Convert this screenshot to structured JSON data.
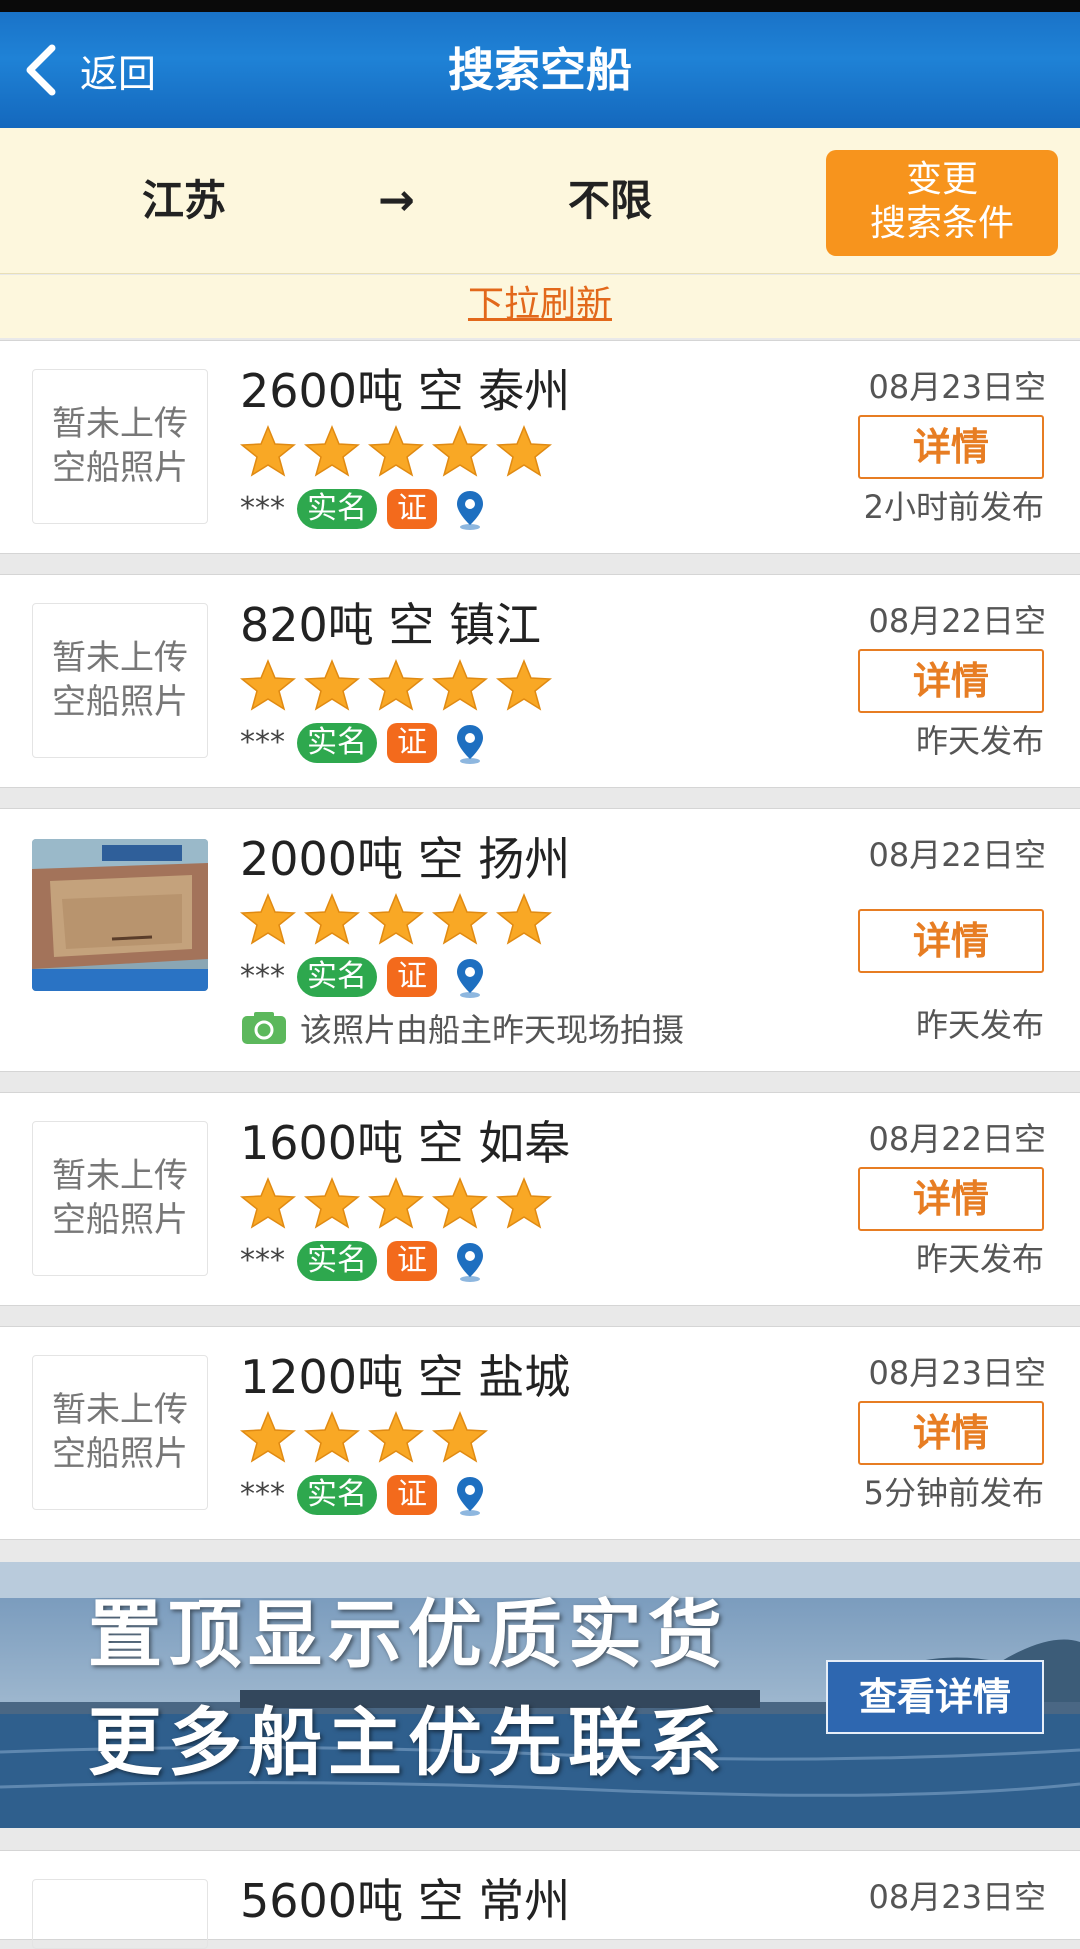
{
  "header": {
    "back_label": "返回",
    "title": "搜索空船"
  },
  "route": {
    "from": "江苏",
    "arrow": "→",
    "to": "不限",
    "change_button_line1": "变更",
    "change_button_line2": "搜索条件"
  },
  "refresh_label": "下拉刷新",
  "ships": [
    {
      "title": "2600吨 空 泰州",
      "date": "08月23日空",
      "detail_label": "详情",
      "posted": "2小时前发布",
      "stars": 5,
      "owner": "***",
      "tag_real": "实名",
      "tag_cert": "证",
      "no_photo_line1": "暂未上传",
      "no_photo_line2": "空船照片"
    },
    {
      "title": "820吨 空 镇江",
      "date": "08月22日空",
      "detail_label": "详情",
      "posted": "昨天发布",
      "stars": 5,
      "owner": "***",
      "tag_real": "实名",
      "tag_cert": "证",
      "no_photo_line1": "暂未上传",
      "no_photo_line2": "空船照片"
    },
    {
      "title": "2000吨 空 扬州",
      "date": "08月22日空",
      "detail_label": "详情",
      "posted": "昨天发布",
      "stars": 5,
      "owner": "***",
      "tag_real": "实名",
      "tag_cert": "证",
      "photo_note": "该照片由船主昨天现场拍摄"
    },
    {
      "title": "1600吨 空 如皋",
      "date": "08月22日空",
      "detail_label": "详情",
      "posted": "昨天发布",
      "stars": 5,
      "owner": "***",
      "tag_real": "实名",
      "tag_cert": "证",
      "no_photo_line1": "暂未上传",
      "no_photo_line2": "空船照片"
    },
    {
      "title": "1200吨 空 盐城",
      "date": "08月23日空",
      "detail_label": "详情",
      "posted": "5分钟前发布",
      "stars": 4,
      "owner": "***",
      "tag_real": "实名",
      "tag_cert": "证",
      "no_photo_line1": "暂未上传",
      "no_photo_line2": "空船照片"
    },
    {
      "title": "5600吨 空 常州",
      "date": "08月23日空"
    }
  ],
  "banner": {
    "line1": "置顶显示优质实货",
    "line2": "更多船主优先联系",
    "button_label": "查看详情"
  },
  "colors": {
    "header_blue": "#1a73c8",
    "accent_orange": "#f7941d",
    "tag_green": "#2ea84e",
    "tag_orange": "#f36a1c",
    "star": "#f9a825"
  },
  "icons": [
    "back-chevron-icon",
    "star-icon",
    "location-pin-icon",
    "camera-icon"
  ]
}
